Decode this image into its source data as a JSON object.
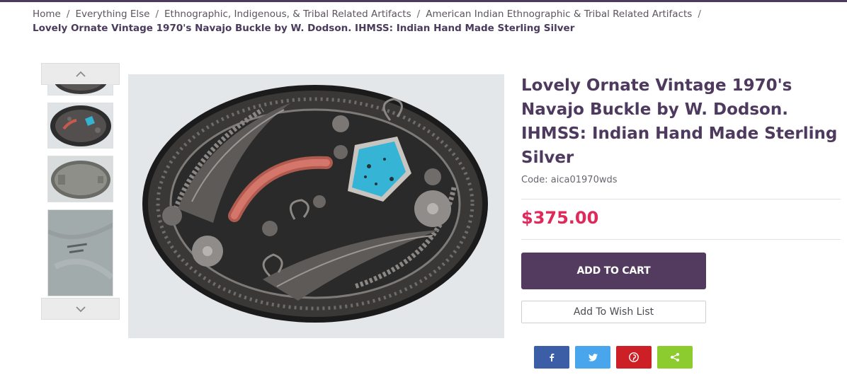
{
  "breadcrumb": {
    "items": [
      "Home",
      "Everything Else",
      "Ethnographic, Indigenous, & Tribal Related Artifacts",
      "American Indian Ethnographic & Tribal Related Artifacts"
    ],
    "separator": "/",
    "current": "Lovely Ornate Vintage 1970's Navajo Buckle by W. Dodson. IHMSS: Indian Hand Made Sterling Silver"
  },
  "gallery": {
    "thumbnails": [
      "buckle-front-cropped",
      "buckle-front",
      "buckle-back",
      "hallmark-closeup"
    ],
    "up_icon": "chevron-up-icon",
    "down_icon": "chevron-down-icon"
  },
  "product": {
    "title": "Lovely Ornate Vintage 1970's Navajo Buckle by W. Dodson. IHMSS: Indian Hand Made Sterling Silver",
    "code": "Code: aica01970wds",
    "price": "$375.00",
    "add_to_cart": "ADD TO CART",
    "add_to_wishlist": "Add To Wish List"
  },
  "share": {
    "facebook_icon": "facebook-icon",
    "twitter_icon": "twitter-icon",
    "pinterest_icon": "pinterest-icon",
    "share_icon": "share-icon"
  },
  "colors": {
    "brand": "#4e3a5e",
    "price": "#e0285a",
    "facebook": "#3b5ea6",
    "twitter": "#4aa6ec",
    "pinterest": "#cc1f26",
    "share": "#8ccc2e"
  }
}
